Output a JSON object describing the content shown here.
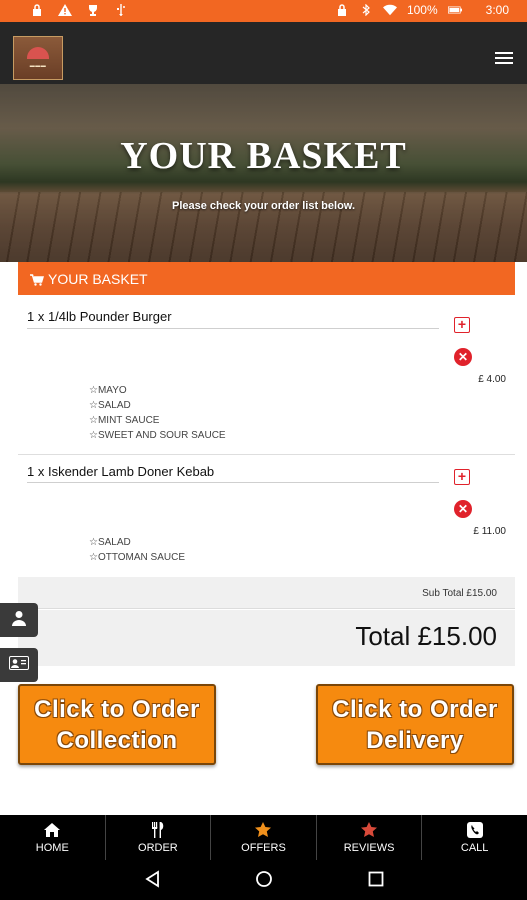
{
  "status_bar": {
    "battery": "100%",
    "time": "3:00"
  },
  "hero": {
    "title": "YOUR BASKET",
    "subtitle": "Please check your order list below."
  },
  "basket": {
    "header": "YOUR BASKET",
    "items": [
      {
        "name": "1 x 1/4lb Pounder Burger",
        "price": "£ 4.00",
        "options": [
          "☆MAYO",
          "☆SALAD",
          "☆MINT SAUCE",
          "☆SWEET AND SOUR SAUCE"
        ]
      },
      {
        "name": "1 x Iskender Lamb Doner Kebab",
        "price": "£ 11.00",
        "options": [
          "☆SALAD",
          "☆OTTOMAN SAUCE"
        ]
      }
    ],
    "subtotal": "Sub Total £15.00",
    "total": "Total £15.00"
  },
  "buttons": {
    "collection": {
      "line1": "Click to Order",
      "line2": "Collection"
    },
    "delivery": {
      "line1": "Click to Order",
      "line2": "Delivery"
    }
  },
  "bottom_nav": [
    {
      "label": "HOME",
      "icon": "home-icon"
    },
    {
      "label": "ORDER",
      "icon": "cutlery-icon"
    },
    {
      "label": "OFFERS",
      "icon": "star-icon"
    },
    {
      "label": "REVIEWS",
      "icon": "star-icon"
    },
    {
      "label": "CALL",
      "icon": "phone-icon"
    }
  ],
  "colors": {
    "accent": "#f26722",
    "button": "#f68a0f",
    "remove": "#e0222b",
    "nav_star_offers": "#f0901c",
    "nav_star_reviews": "#d84a3a"
  }
}
